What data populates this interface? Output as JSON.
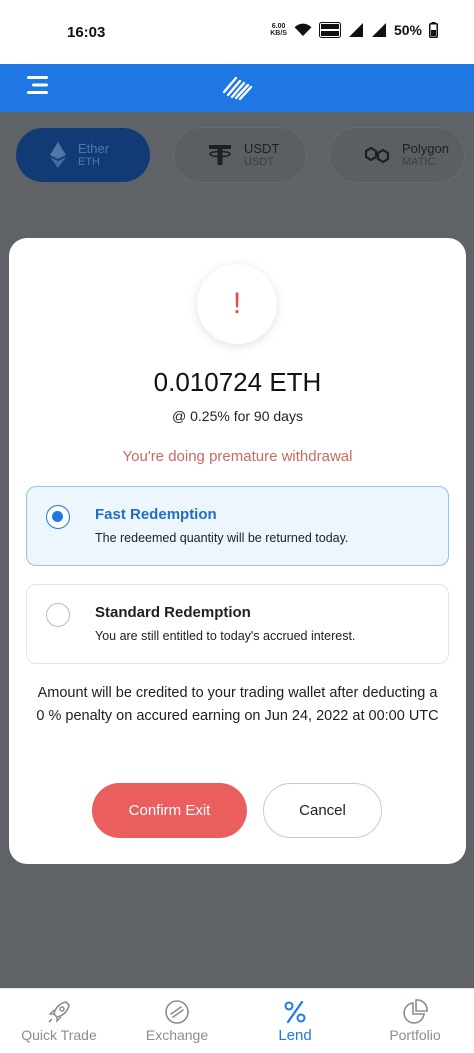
{
  "status_bar": {
    "time": "16:03",
    "net_speed_value": "6.00",
    "net_speed_unit": "KB/S",
    "wifi_badge_top": "Vo)",
    "wifi_badge_bottom": "WiFi2",
    "battery": "50%"
  },
  "header": {
    "menu_icon": "hamburger-menu-icon",
    "logo_icon": "app-logo-icon",
    "color": "#1f77e4"
  },
  "assets": [
    {
      "name": "Ether",
      "symbol": "ETH",
      "icon": "ethereum-icon",
      "selected": true
    },
    {
      "name": "USDT",
      "symbol": "USDT",
      "icon": "tether-icon",
      "selected": false
    },
    {
      "name": "Polygon",
      "symbol": "MATIC",
      "icon": "polygon-icon",
      "selected": false
    }
  ],
  "modal": {
    "alert_symbol": "!",
    "amount": "0.010724 ETH",
    "rate": "@ 0.25% for 90 days",
    "warning": "You're doing premature withdrawal",
    "options": [
      {
        "title": "Fast Redemption",
        "description": "The redeemed quantity will be returned today.",
        "selected": true
      },
      {
        "title": "Standard Redemption",
        "description": "You are still entitled to today's accrued interest.",
        "selected": false
      }
    ],
    "info": "Amount will be credited to your trading wallet after deducting a 0 % penalty on accured earning on Jun 24, 2022 at 00:00 UTC",
    "confirm_label": "Confirm Exit",
    "cancel_label": "Cancel",
    "confirm_color": "#ea5e5e",
    "warning_color": "#c86a5f"
  },
  "bottom_nav": [
    {
      "label": "Quick Trade",
      "icon": "rocket-icon",
      "active": false
    },
    {
      "label": "Exchange",
      "icon": "exchange-icon",
      "active": false
    },
    {
      "label": "Lend",
      "icon": "percent-icon",
      "active": true
    },
    {
      "label": "Portfolio",
      "icon": "pie-chart-icon",
      "active": false
    }
  ]
}
